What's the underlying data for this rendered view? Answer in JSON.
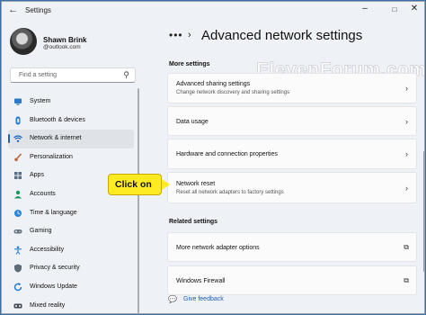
{
  "window": {
    "title": "Settings"
  },
  "user": {
    "name": "Shawn Brink",
    "email": "@outlook.com"
  },
  "search": {
    "placeholder": "Find a setting"
  },
  "nav": [
    {
      "label": "System",
      "icon": "monitor-icon",
      "color": "#2b79c7",
      "active": false
    },
    {
      "label": "Bluetooth & devices",
      "icon": "bluetooth-icon",
      "color": "#1b74d3",
      "active": false
    },
    {
      "label": "Network & internet",
      "icon": "wifi-icon",
      "color": "#1a64b8",
      "active": true
    },
    {
      "label": "Personalization",
      "icon": "brush-icon",
      "color": "#c0683a",
      "active": false
    },
    {
      "label": "Apps",
      "icon": "apps-icon",
      "color": "#5a6e86",
      "active": false
    },
    {
      "label": "Accounts",
      "icon": "person-icon",
      "color": "#1f9a58",
      "active": false
    },
    {
      "label": "Time & language",
      "icon": "globe-clock-icon",
      "color": "#2a84d8",
      "active": false
    },
    {
      "label": "Gaming",
      "icon": "gamepad-icon",
      "color": "#677482",
      "active": false
    },
    {
      "label": "Accessibility",
      "icon": "accessibility-icon",
      "color": "#2c7fd6",
      "active": false
    },
    {
      "label": "Privacy & security",
      "icon": "shield-icon",
      "color": "#5e6b78",
      "active": false
    },
    {
      "label": "Windows Update",
      "icon": "update-icon",
      "color": "#1a73d0",
      "active": false
    },
    {
      "label": "Mixed reality",
      "icon": "headset-icon",
      "color": "#444c55",
      "active": false
    }
  ],
  "header": {
    "title": "Advanced network settings"
  },
  "more_settings": {
    "heading": "More settings",
    "items": [
      {
        "title": "Advanced sharing settings",
        "subtitle": "Change network discovery and sharing settings"
      },
      {
        "title": "Data usage",
        "subtitle": ""
      },
      {
        "title": "Hardware and connection properties",
        "subtitle": ""
      },
      {
        "title": "Network reset",
        "subtitle": "Reset all network adapters to factory settings"
      }
    ]
  },
  "related_settings": {
    "heading": "Related settings",
    "items": [
      {
        "title": "More network adapter options"
      },
      {
        "title": "Windows Firewall"
      }
    ]
  },
  "feedback": {
    "label": "Give feedback"
  },
  "watermark": "ElevenForum.com",
  "callout": {
    "label": "Click on"
  },
  "colors": {
    "accent": "#1a64b8",
    "callout": "#ffeb22",
    "link": "#1a5fb4"
  }
}
